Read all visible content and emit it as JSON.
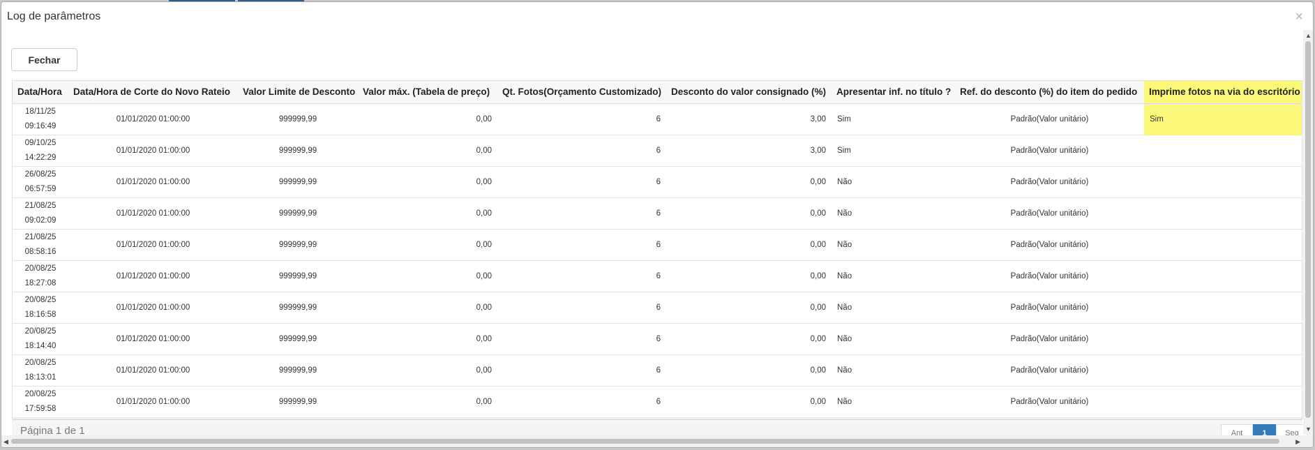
{
  "dialog": {
    "title": "Log de parâmetros",
    "close_glyph": "×",
    "close_button": "Fechar"
  },
  "table": {
    "columns": [
      "Data/Hora",
      "Data/Hora de Corte do Novo Rateio",
      "Valor Limite de Desconto",
      "Valor máx. (Tabela de preço)",
      "Qt. Fotos(Orçamento Customizado)",
      "Desconto do valor consignado (%)",
      "Apresentar inf. no título ?",
      "Ref. do desconto (%) do item do pedido",
      "Imprime fotos na via do escritório"
    ],
    "rows": [
      {
        "date": "18/11/25",
        "time": "09:16:49",
        "corte": "01/01/2020 01:00:00",
        "limite": "999999,99",
        "valor_max": "0,00",
        "qt_fotos": "6",
        "desconto": "3,00",
        "apresentar": "Sim",
        "ref": "Padrão(Valor unitário)",
        "imprime": "Sim"
      },
      {
        "date": "09/10/25",
        "time": "14:22:29",
        "corte": "01/01/2020 01:00:00",
        "limite": "999999,99",
        "valor_max": "0,00",
        "qt_fotos": "6",
        "desconto": "3,00",
        "apresentar": "Sim",
        "ref": "Padrão(Valor unitário)",
        "imprime": ""
      },
      {
        "date": "26/08/25",
        "time": "06:57:59",
        "corte": "01/01/2020 01:00:00",
        "limite": "999999,99",
        "valor_max": "0,00",
        "qt_fotos": "6",
        "desconto": "0,00",
        "apresentar": "Não",
        "ref": "Padrão(Valor unitário)",
        "imprime": ""
      },
      {
        "date": "21/08/25",
        "time": "09:02:09",
        "corte": "01/01/2020 01:00:00",
        "limite": "999999,99",
        "valor_max": "0,00",
        "qt_fotos": "6",
        "desconto": "0,00",
        "apresentar": "Não",
        "ref": "Padrão(Valor unitário)",
        "imprime": ""
      },
      {
        "date": "21/08/25",
        "time": "08:58:16",
        "corte": "01/01/2020 01:00:00",
        "limite": "999999,99",
        "valor_max": "0,00",
        "qt_fotos": "6",
        "desconto": "0,00",
        "apresentar": "Não",
        "ref": "Padrão(Valor unitário)",
        "imprime": ""
      },
      {
        "date": "20/08/25",
        "time": "18:27:08",
        "corte": "01/01/2020 01:00:00",
        "limite": "999999,99",
        "valor_max": "0,00",
        "qt_fotos": "6",
        "desconto": "0,00",
        "apresentar": "Não",
        "ref": "Padrão(Valor unitário)",
        "imprime": ""
      },
      {
        "date": "20/08/25",
        "time": "18:16:58",
        "corte": "01/01/2020 01:00:00",
        "limite": "999999,99",
        "valor_max": "0,00",
        "qt_fotos": "6",
        "desconto": "0,00",
        "apresentar": "Não",
        "ref": "Padrão(Valor unitário)",
        "imprime": ""
      },
      {
        "date": "20/08/25",
        "time": "18:14:40",
        "corte": "01/01/2020 01:00:00",
        "limite": "999999,99",
        "valor_max": "0,00",
        "qt_fotos": "6",
        "desconto": "0,00",
        "apresentar": "Não",
        "ref": "Padrão(Valor unitário)",
        "imprime": ""
      },
      {
        "date": "20/08/25",
        "time": "18:13:01",
        "corte": "01/01/2020 01:00:00",
        "limite": "999999,99",
        "valor_max": "0,00",
        "qt_fotos": "6",
        "desconto": "0,00",
        "apresentar": "Não",
        "ref": "Padrão(Valor unitário)",
        "imprime": ""
      },
      {
        "date": "20/08/25",
        "time": "17:59:58",
        "corte": "01/01/2020 01:00:00",
        "limite": "999999,99",
        "valor_max": "0,00",
        "qt_fotos": "6",
        "desconto": "0,00",
        "apresentar": "Não",
        "ref": "Padrão(Valor unitário)",
        "imprime": ""
      }
    ]
  },
  "pager": {
    "label": "Página 1 de 1",
    "prev": "Ant",
    "current": "1",
    "next": "Seg"
  },
  "colors": {
    "highlight": "#fbf87a",
    "pager_active": "#337ab7"
  }
}
